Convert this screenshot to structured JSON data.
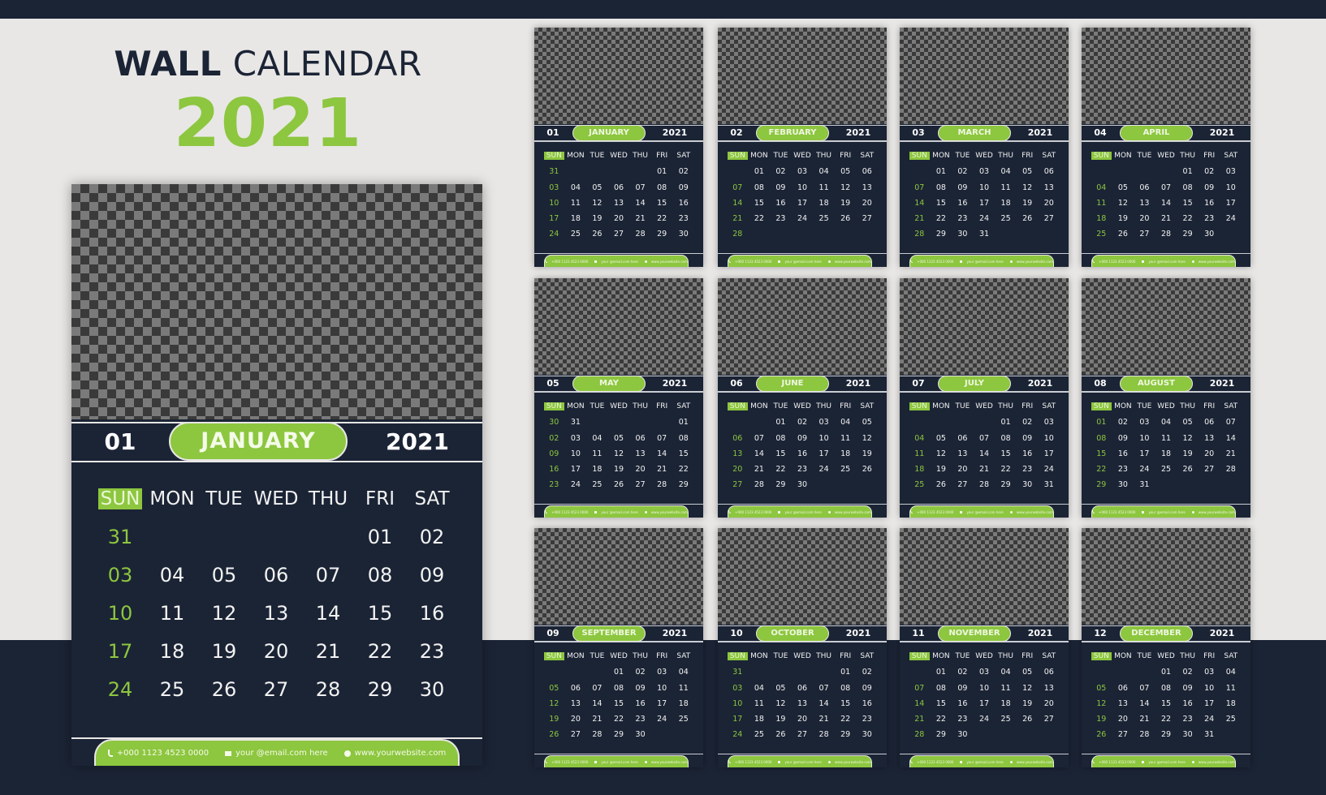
{
  "title": {
    "bold": "WALL",
    "light": "CALENDAR",
    "year": "2021"
  },
  "colors": {
    "navy": "#1b2435",
    "green": "#8dc63f",
    "background": "#e8e7e5"
  },
  "weekdays": [
    "SUN",
    "MON",
    "TUE",
    "WED",
    "THU",
    "FRI",
    "SAT"
  ],
  "footer": {
    "phone": "+000 1123 4523 0000",
    "email": "your @email.com here",
    "website": "www.yourwebsite.com",
    "icons": [
      "phone-icon",
      "mail-icon",
      "globe-icon"
    ]
  },
  "featured": {
    "number": "01",
    "month": "JANUARY",
    "year": "2021",
    "month_index": 0
  },
  "months": [
    {
      "number": "01",
      "name": "JANUARY",
      "year": "2021",
      "weeks": [
        [
          "31",
          "",
          "",
          "",
          "",
          "01",
          "02"
        ],
        [
          "03",
          "04",
          "05",
          "06",
          "07",
          "08",
          "09"
        ],
        [
          "10",
          "11",
          "12",
          "13",
          "14",
          "15",
          "16"
        ],
        [
          "17",
          "18",
          "19",
          "20",
          "21",
          "22",
          "23"
        ],
        [
          "24",
          "25",
          "26",
          "27",
          "28",
          "29",
          "30"
        ]
      ]
    },
    {
      "number": "02",
      "name": "FEBRUARY",
      "year": "2021",
      "weeks": [
        [
          "",
          "01",
          "02",
          "03",
          "04",
          "05",
          "06"
        ],
        [
          "07",
          "08",
          "09",
          "10",
          "11",
          "12",
          "13"
        ],
        [
          "14",
          "15",
          "16",
          "17",
          "18",
          "19",
          "20"
        ],
        [
          "21",
          "22",
          "23",
          "24",
          "25",
          "26",
          "27"
        ],
        [
          "28",
          "",
          "",
          "",
          "",
          "",
          ""
        ]
      ]
    },
    {
      "number": "03",
      "name": "MARCH",
      "year": "2021",
      "weeks": [
        [
          "",
          "01",
          "02",
          "03",
          "04",
          "05",
          "06"
        ],
        [
          "07",
          "08",
          "09",
          "10",
          "11",
          "12",
          "13"
        ],
        [
          "14",
          "15",
          "16",
          "17",
          "18",
          "19",
          "20"
        ],
        [
          "21",
          "22",
          "23",
          "24",
          "25",
          "26",
          "27"
        ],
        [
          "28",
          "29",
          "30",
          "31",
          "",
          "",
          ""
        ]
      ]
    },
    {
      "number": "04",
      "name": "APRIL",
      "year": "2021",
      "weeks": [
        [
          "",
          "",
          "",
          "",
          "01",
          "02",
          "03"
        ],
        [
          "04",
          "05",
          "06",
          "07",
          "08",
          "09",
          "10"
        ],
        [
          "11",
          "12",
          "13",
          "14",
          "15",
          "16",
          "17"
        ],
        [
          "18",
          "19",
          "20",
          "21",
          "22",
          "23",
          "24"
        ],
        [
          "25",
          "26",
          "27",
          "28",
          "29",
          "30",
          ""
        ]
      ]
    },
    {
      "number": "05",
      "name": "MAY",
      "year": "2021",
      "weeks": [
        [
          "30",
          "31",
          "",
          "",
          "",
          "",
          "01"
        ],
        [
          "02",
          "03",
          "04",
          "05",
          "06",
          "07",
          "08"
        ],
        [
          "09",
          "10",
          "11",
          "12",
          "13",
          "14",
          "15"
        ],
        [
          "16",
          "17",
          "18",
          "19",
          "20",
          "21",
          "22"
        ],
        [
          "23",
          "24",
          "25",
          "26",
          "27",
          "28",
          "29"
        ]
      ]
    },
    {
      "number": "06",
      "name": "JUNE",
      "year": "2021",
      "weeks": [
        [
          "",
          "",
          "01",
          "02",
          "03",
          "04",
          "05"
        ],
        [
          "06",
          "07",
          "08",
          "09",
          "10",
          "11",
          "12"
        ],
        [
          "13",
          "14",
          "15",
          "16",
          "17",
          "18",
          "19"
        ],
        [
          "20",
          "21",
          "22",
          "23",
          "24",
          "25",
          "26"
        ],
        [
          "27",
          "28",
          "29",
          "30",
          "",
          "",
          ""
        ]
      ]
    },
    {
      "number": "07",
      "name": "JULY",
      "year": "2021",
      "weeks": [
        [
          "",
          "",
          "",
          "",
          "01",
          "02",
          "03"
        ],
        [
          "04",
          "05",
          "06",
          "07",
          "08",
          "09",
          "10"
        ],
        [
          "11",
          "12",
          "13",
          "14",
          "15",
          "16",
          "17"
        ],
        [
          "18",
          "19",
          "20",
          "21",
          "22",
          "23",
          "24"
        ],
        [
          "25",
          "26",
          "27",
          "28",
          "29",
          "30",
          "31"
        ]
      ]
    },
    {
      "number": "08",
      "name": "AUGUST",
      "year": "2021",
      "weeks": [
        [
          "01",
          "02",
          "03",
          "04",
          "05",
          "06",
          "07"
        ],
        [
          "08",
          "09",
          "10",
          "11",
          "12",
          "13",
          "14"
        ],
        [
          "15",
          "16",
          "17",
          "18",
          "19",
          "20",
          "21"
        ],
        [
          "22",
          "23",
          "24",
          "25",
          "26",
          "27",
          "28"
        ],
        [
          "29",
          "30",
          "31",
          "",
          "",
          "",
          ""
        ]
      ]
    },
    {
      "number": "09",
      "name": "SEPTEMBER",
      "year": "2021",
      "weeks": [
        [
          "",
          "",
          "",
          "01",
          "02",
          "03",
          "04"
        ],
        [
          "05",
          "06",
          "07",
          "08",
          "09",
          "10",
          "11"
        ],
        [
          "12",
          "13",
          "14",
          "15",
          "16",
          "17",
          "18"
        ],
        [
          "19",
          "20",
          "21",
          "22",
          "23",
          "24",
          "25"
        ],
        [
          "26",
          "27",
          "28",
          "29",
          "30",
          "",
          ""
        ]
      ]
    },
    {
      "number": "10",
      "name": "OCTOBER",
      "year": "2021",
      "weeks": [
        [
          "31",
          "",
          "",
          "",
          "",
          "01",
          "02"
        ],
        [
          "03",
          "04",
          "05",
          "06",
          "07",
          "08",
          "09"
        ],
        [
          "10",
          "11",
          "12",
          "13",
          "14",
          "15",
          "16"
        ],
        [
          "17",
          "18",
          "19",
          "20",
          "21",
          "22",
          "23"
        ],
        [
          "24",
          "25",
          "26",
          "27",
          "28",
          "29",
          "30"
        ]
      ]
    },
    {
      "number": "11",
      "name": "NOVEMBER",
      "year": "2021",
      "weeks": [
        [
          "",
          "01",
          "02",
          "03",
          "04",
          "05",
          "06"
        ],
        [
          "07",
          "08",
          "09",
          "10",
          "11",
          "12",
          "13"
        ],
        [
          "14",
          "15",
          "16",
          "17",
          "18",
          "19",
          "20"
        ],
        [
          "21",
          "22",
          "23",
          "24",
          "25",
          "26",
          "27"
        ],
        [
          "28",
          "29",
          "30",
          "",
          "",
          "",
          ""
        ]
      ]
    },
    {
      "number": "12",
      "name": "DECEMBER",
      "year": "2021",
      "weeks": [
        [
          "",
          "",
          "",
          "01",
          "02",
          "03",
          "04"
        ],
        [
          "05",
          "06",
          "07",
          "08",
          "09",
          "10",
          "11"
        ],
        [
          "12",
          "13",
          "14",
          "15",
          "16",
          "17",
          "18"
        ],
        [
          "19",
          "20",
          "21",
          "22",
          "23",
          "24",
          "25"
        ],
        [
          "26",
          "27",
          "28",
          "29",
          "30",
          "31",
          ""
        ]
      ]
    }
  ]
}
